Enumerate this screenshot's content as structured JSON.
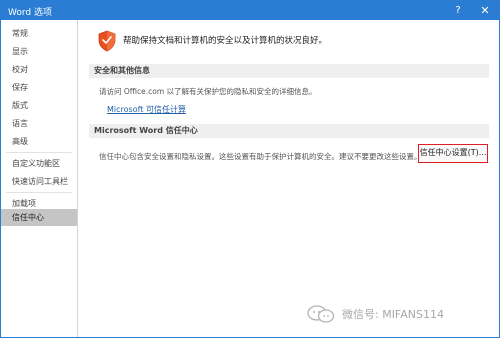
{
  "window": {
    "title": "Word 选项",
    "help_glyph": "?",
    "close_glyph": "✕",
    "accent_color": "#2b7cd3"
  },
  "sidebar": {
    "items": [
      {
        "label": "常规"
      },
      {
        "label": "显示"
      },
      {
        "label": "校对"
      },
      {
        "label": "保存"
      },
      {
        "label": "版式"
      },
      {
        "label": "语言"
      },
      {
        "label": "高级"
      },
      {
        "label": "自定义功能区"
      },
      {
        "label": "快速访问工具栏"
      },
      {
        "label": "加载项"
      },
      {
        "label": "信任中心",
        "selected": true
      }
    ]
  },
  "main": {
    "header_text": "帮助保持文档和计算机的安全以及计算机的状况良好。",
    "header_icon": "shield-icon",
    "security_section": {
      "title": "安全和其他信息",
      "description": "请访问 Office.com 以了解有关保护您的隐私和安全的详细信息。",
      "link_text": "Microsoft 可信任计算"
    },
    "trust_center_section": {
      "title": "Microsoft Word 信任中心",
      "description": "信任中心包含安全设置和隐私设置。这些设置有助于保护计算机的安全。建议不要更改这些设置。",
      "button_label": "信任中心设置(T)...",
      "button_highlight_color": "#e02020"
    }
  },
  "watermark": {
    "text": "微信号: MIFANS114",
    "icon": "wechat-icon"
  }
}
